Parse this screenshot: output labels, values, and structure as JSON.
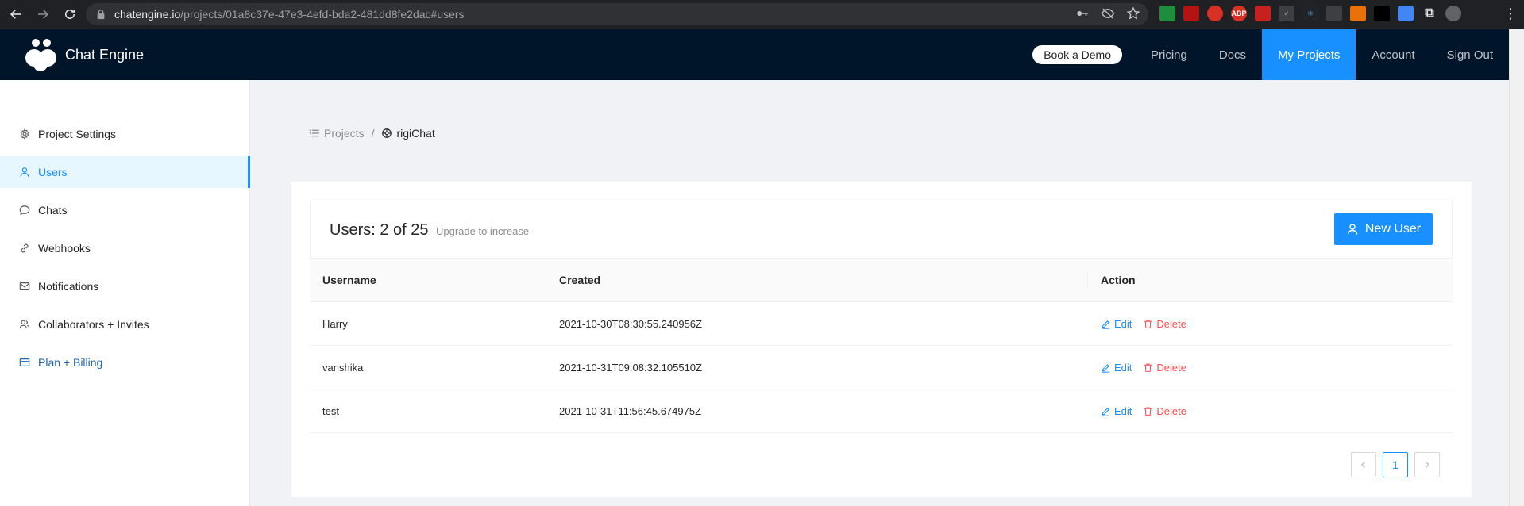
{
  "browser": {
    "url_host": "chatengine.io",
    "url_path": "/projects/01a8c37e-47e3-4efd-bda2-481dd8fe2dac#users",
    "extension_badges": [
      "ABP"
    ]
  },
  "header": {
    "brand": "Chat Engine",
    "demo_button": "Book a Demo",
    "nav": [
      "Pricing",
      "Docs",
      "My Projects",
      "Account",
      "Sign Out"
    ],
    "active_nav": "My Projects"
  },
  "sidebar": {
    "items": [
      {
        "label": "Project Settings",
        "icon": "gear-icon"
      },
      {
        "label": "Users",
        "icon": "user-icon"
      },
      {
        "label": "Chats",
        "icon": "chat-icon"
      },
      {
        "label": "Webhooks",
        "icon": "webhook-icon"
      },
      {
        "label": "Notifications",
        "icon": "mail-icon"
      },
      {
        "label": "Collaborators + Invites",
        "icon": "team-icon"
      },
      {
        "label": "Plan + Billing",
        "icon": "credit-card-icon"
      }
    ],
    "active": "Users"
  },
  "breadcrumb": {
    "root": "Projects",
    "separator": "/",
    "current": "rigiChat"
  },
  "card": {
    "title": "Users: 2 of 25",
    "subtitle": "Upgrade to increase",
    "new_user_button": "New User"
  },
  "table": {
    "columns": [
      "Username",
      "Created",
      "Action"
    ],
    "rows": [
      {
        "username": "Harry",
        "created": "2021-10-30T08:30:55.240956Z"
      },
      {
        "username": "vanshika",
        "created": "2021-10-31T09:08:32.105510Z"
      },
      {
        "username": "test",
        "created": "2021-10-31T11:56:45.674975Z"
      }
    ],
    "edit_label": "Edit",
    "delete_label": "Delete"
  },
  "pagination": {
    "current_page": "1"
  },
  "colors": {
    "header_bg": "#001529",
    "accent": "#1890ff",
    "danger": "#ff4d4f"
  }
}
